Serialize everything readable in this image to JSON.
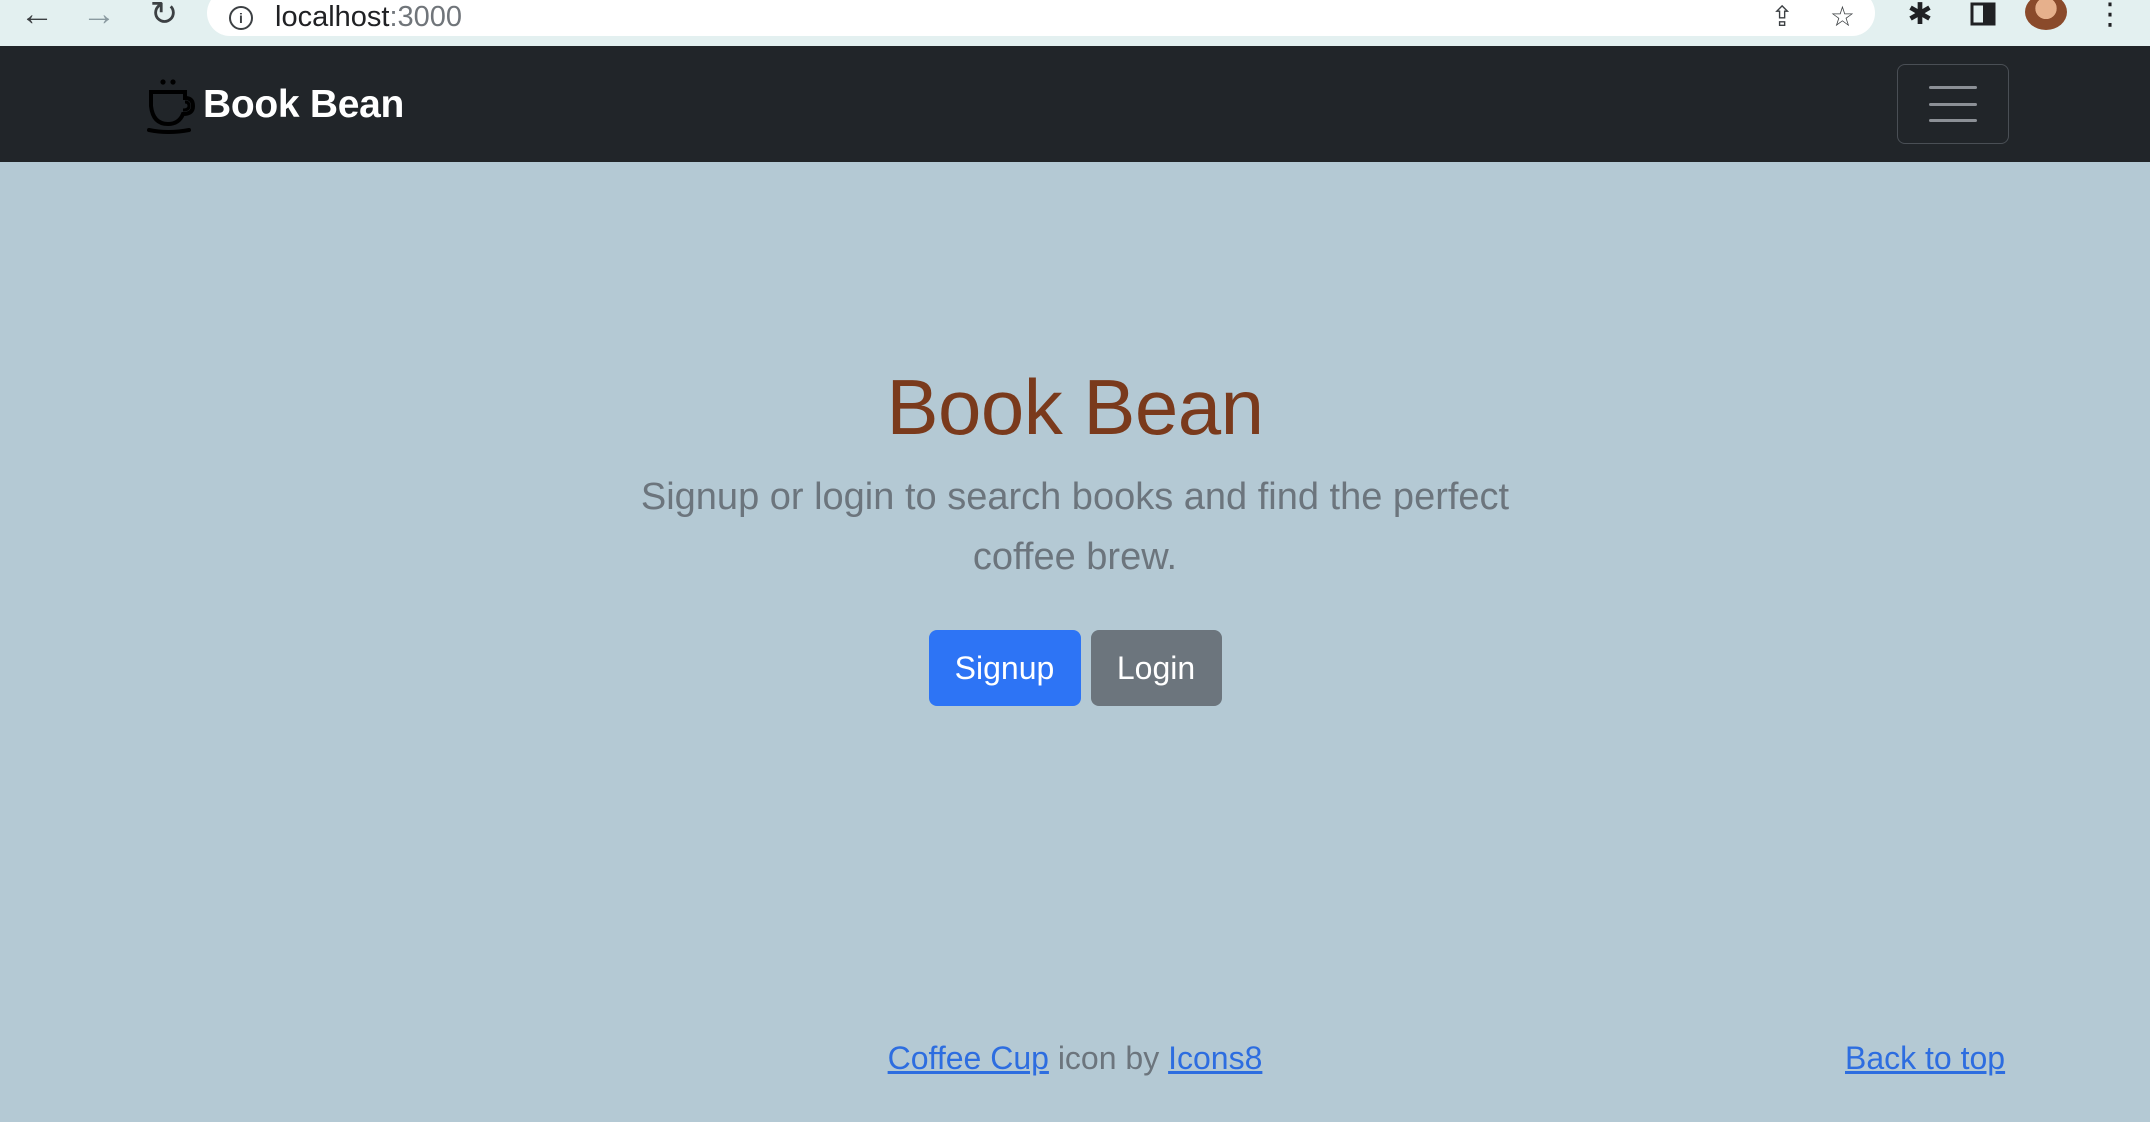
{
  "browser": {
    "url_host": "localhost",
    "url_port": ":3000"
  },
  "navbar": {
    "brand": "Book Bean"
  },
  "hero": {
    "title": "Book Bean",
    "lead": "Signup or login to search books and find the perfect coffee brew.",
    "signup_label": "Signup",
    "login_label": "Login"
  },
  "footer": {
    "icon_link": "Coffee Cup",
    "middle_text": " icon by ",
    "author_link": "Icons8",
    "back_to_top": "Back to top"
  },
  "colors": {
    "page_bg": "#b4c9d4",
    "navbar_bg": "#212529",
    "title": "#7a3a1c",
    "primary": "#2d74f5",
    "secondary": "#6c757d",
    "link": "#2d6de0"
  },
  "icons": [
    "back-arrow-icon",
    "forward-arrow-icon",
    "reload-icon",
    "info-icon",
    "share-icon",
    "star-icon",
    "extensions-icon",
    "side-panel-icon",
    "profile-avatar",
    "menu-dots-icon",
    "coffee-cup-icon",
    "hamburger-icon"
  ]
}
